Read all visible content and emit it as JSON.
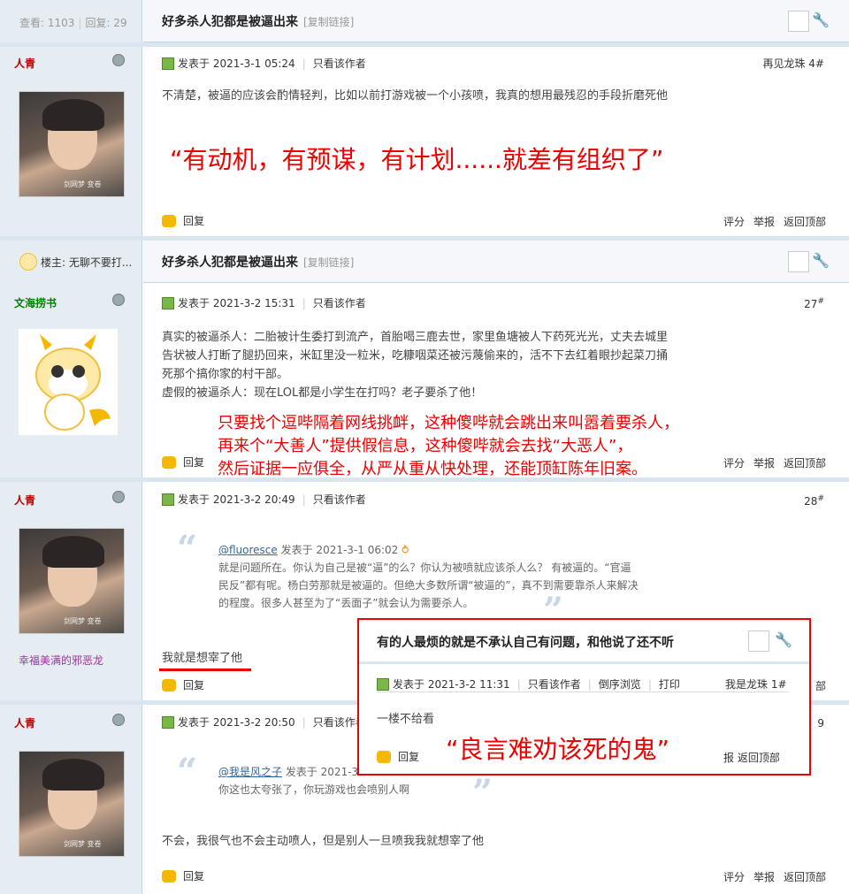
{
  "header": {
    "views_label": "查看: 1103",
    "replies_label": "回复: 29",
    "title": "好多杀人犯都是被逼出来",
    "copy_link": "[复制链接]"
  },
  "thread_header2": {
    "owner_label": "楼主: 无聊不要打...",
    "title": "好多杀人犯都是被逼出来",
    "copy_link": "[复制链接]"
  },
  "posts": [
    {
      "author": "人青",
      "posted": "发表于  2021-3-1 05:24",
      "only_author": "只看该作者",
      "floor_label": "再见龙珠 4#",
      "body": "不清楚，被逼的应该会酌情轻判，比如以前打游戏被一个小孩喷，我真的想用最残忍的手段折磨死他",
      "annotation": "“有动机，有预谋，有计划......就差有组织了”",
      "reply": "回复",
      "actions": [
        "评分",
        "举报",
        "返回顶部"
      ]
    },
    {
      "author": "文海捞书",
      "posted": "发表于  2021-3-2 15:31",
      "only_author": "只看该作者",
      "floor": "27",
      "floor_sup": "#",
      "body_lines": [
        "真实的被逼杀人：二胎被计生委打到流产，首胎喝三鹿去世，家里鱼塘被人下药死光光，丈夫去城里",
        "告状被人打断了腿扔回来，米缸里没一粒米，吃糠咽菜还被污蔑偷来的，活不下去红着眼抄起菜刀捅",
        "死那个搞你家的村干部。",
        "虚假的被逼杀人：现在LOL都是小学生在打吗？老子要杀了他！"
      ],
      "annotation_lines": [
        "只要找个逗哔隔着网线挑衅，这种傻哔就会跳出来叫嚣着要杀人，",
        "再来个“大善人”提供假信息，这种傻哔就会去找“大恶人”，",
        "然后证据一应俱全，从严从重从快处理，还能顶缸陈年旧案。"
      ],
      "reply": "回复",
      "actions": [
        "评分",
        "举报",
        "返回顶部"
      ]
    },
    {
      "author": "人青",
      "posted": "发表于  2021-3-2 20:49",
      "only_author": "只看该作者",
      "floor": "28",
      "floor_sup": "#",
      "quote_user": "@fluoresce",
      "quote_meta": "发表于  2021-3-1 06:02",
      "quote_lines": [
        "就是问题所在。你认为自己是被“逼”的么？你认为被喷就应该杀人么？ 有被逼的。“官逼",
        "民反”都有呢。杨白劳那就是被逼的。但绝大多数所谓“被逼的”，真不到需要靠杀人来解决",
        "的程度。很多人甚至为了“丢面子”就会认为需要杀人。"
      ],
      "body": "我就是想宰了他",
      "signature": "幸福美满的邪恶龙",
      "reply": "回复",
      "actions_tail": "部"
    },
    {
      "author": "人青",
      "posted": "发表于  2021-3-2 20:50",
      "only_author": "只看该作者",
      "floor_tail": "9",
      "quote_user": "@我是风之子",
      "quote_meta": "发表于  2021-3",
      "quote_line": "你这也太夸张了，你玩游戏也会喷别人啊",
      "body": "不会，我很气也不会主动喷人，但是别人一旦喷我我就想宰了他",
      "reply": "回复",
      "actions": [
        "评分",
        "举报",
        "返回顶部"
      ]
    }
  ],
  "overlay": {
    "title": "有的人最烦的就是不承认自己有问题，和他说了还不听",
    "posted": "发表于  2021-3-2 11:31",
    "only_author": "只看该作者",
    "reverse": "倒序浏览",
    "print": "打印",
    "floor_label": "我是龙珠 1#",
    "body": "一楼不给看",
    "annotation": "“良言难劝该死的鬼”",
    "reply": "回复",
    "actions": "报  返回顶部"
  }
}
